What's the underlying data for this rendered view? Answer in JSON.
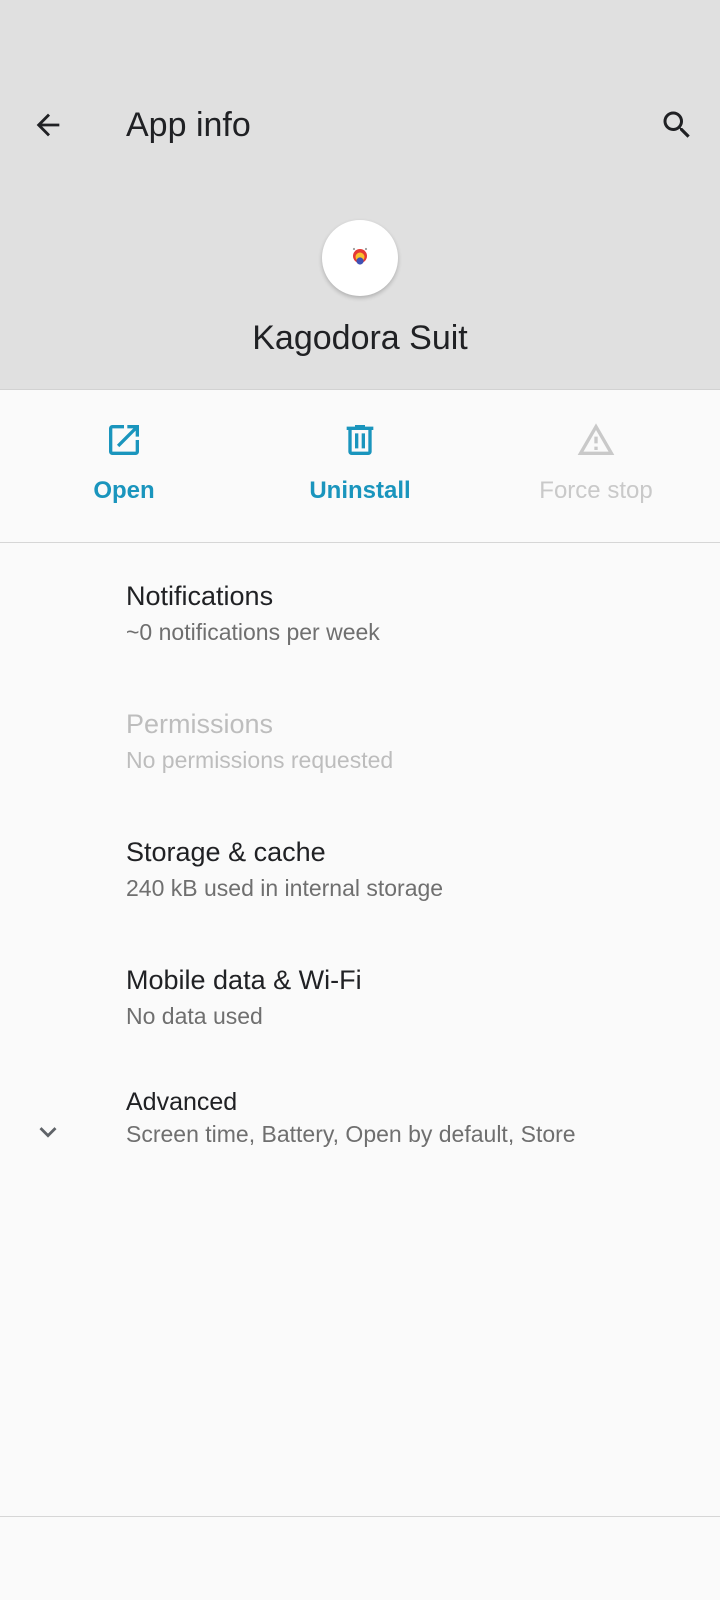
{
  "header": {
    "title": "App info",
    "back_icon": "arrow-back-icon",
    "search_icon": "search-icon"
  },
  "app": {
    "name": "Kagodora Suit",
    "icon": "app-logo-icon"
  },
  "actions": [
    {
      "label": "Open",
      "icon": "open-external-icon",
      "enabled": true
    },
    {
      "label": "Uninstall",
      "icon": "trash-icon",
      "enabled": true
    },
    {
      "label": "Force stop",
      "icon": "warning-icon",
      "enabled": false
    }
  ],
  "items": [
    {
      "title": "Notifications",
      "subtitle": "~0 notifications per week",
      "enabled": true
    },
    {
      "title": "Permissions",
      "subtitle": "No permissions requested",
      "enabled": false
    },
    {
      "title": "Storage & cache",
      "subtitle": "240 kB used in internal storage",
      "enabled": true
    },
    {
      "title": "Mobile data & Wi-Fi",
      "subtitle": "No data used",
      "enabled": true
    },
    {
      "title": "Advanced",
      "subtitle": "Screen time, Battery, Open by default, Store",
      "enabled": true,
      "icon": "chevron-down-icon"
    }
  ],
  "colors": {
    "header_bg": "#e0e0e0",
    "body_bg": "#fafafa",
    "accent": "#1a95bd",
    "disabled": "#c9c9c9"
  }
}
